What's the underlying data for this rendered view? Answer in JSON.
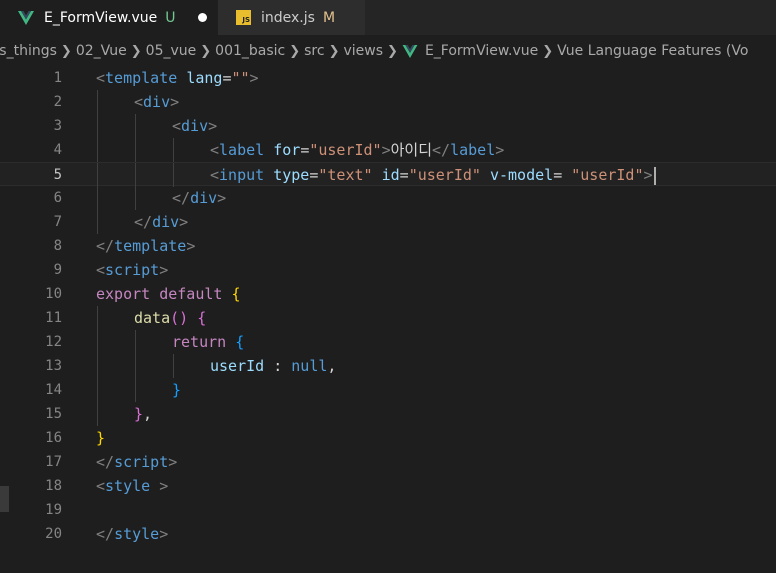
{
  "tabs": [
    {
      "name": "E_FormView.vue",
      "status": "U",
      "active": true,
      "dirty": true
    },
    {
      "name": "index.js",
      "status": "M",
      "active": false,
      "icon_text": "JS"
    }
  ],
  "breadcrumb": [
    "ss_things",
    "02_Vue",
    "05_vue",
    "001_basic",
    "src",
    "views",
    "E_FormView.vue",
    "Vue Language Features (Vo"
  ],
  "line_numbers": [
    "1",
    "2",
    "3",
    "4",
    "5",
    "6",
    "7",
    "8",
    "9",
    "10",
    "11",
    "12",
    "13",
    "14",
    "15",
    "16",
    "17",
    "18",
    "19",
    "20"
  ],
  "current_line": 5,
  "code": {
    "l1": {
      "lt": "<",
      "tag": "template",
      "sp": " ",
      "attr": "lang",
      "eq": "=",
      "val": "\"\"",
      "gt": ">"
    },
    "l2": {
      "lt": "<",
      "tag": "div",
      "gt": ">"
    },
    "l3": {
      "lt": "<",
      "tag": "div",
      "gt": ">"
    },
    "l4": {
      "lt": "<",
      "tag": "label",
      "sp": " ",
      "attr": "for",
      "eq": "=",
      "val": "\"userId\"",
      "gt": ">",
      "text": "아이디",
      "close_lt": "</",
      "close_tag": "label",
      "close_gt": ">"
    },
    "l5": {
      "lt": "<",
      "tag": "input",
      "attr1": "type",
      "eq1": "=",
      "val1": "\"text\"",
      "attr2": "id",
      "eq2": "=",
      "val2": "\"userId\"",
      "attr3": "v-model",
      "eq3": "= ",
      "val3": "\"userId\"",
      "gt": ">"
    },
    "l6": {
      "lt": "</",
      "tag": "div",
      "gt": ">"
    },
    "l7": {
      "lt": "</",
      "tag": "div",
      "gt": ">"
    },
    "l8": {
      "lt": "</",
      "tag": "template",
      "gt": ">"
    },
    "l9": {
      "lt": "<",
      "tag": "script",
      "gt": ">"
    },
    "l10": {
      "kw1": "export",
      "kw2": "default",
      "brace": "{"
    },
    "l11": {
      "fn": "data",
      "parens": "()",
      "brace": "{"
    },
    "l12": {
      "kw": "return",
      "brace": "{"
    },
    "l13": {
      "prop": "userId",
      "colon": " : ",
      "value": "null",
      "comma": ","
    },
    "l14": {
      "brace": "}"
    },
    "l15": {
      "brace": "}",
      "comma": ","
    },
    "l16": {
      "brace": "}"
    },
    "l17": {
      "lt": "</",
      "tag": "script",
      "gt": ">"
    },
    "l18": {
      "lt": "<",
      "tag": "style",
      "gt": " >"
    },
    "l20": {
      "lt": "</",
      "tag": "style",
      "gt": ">"
    }
  },
  "colors": {
    "background": "#1e1e1e",
    "tag": "#569cd6",
    "attribute": "#9cdcfe",
    "string": "#ce9178",
    "keyword": "#c586c0",
    "function": "#dcdcaa",
    "untracked": "#73c991",
    "modified": "#e2c08d"
  }
}
